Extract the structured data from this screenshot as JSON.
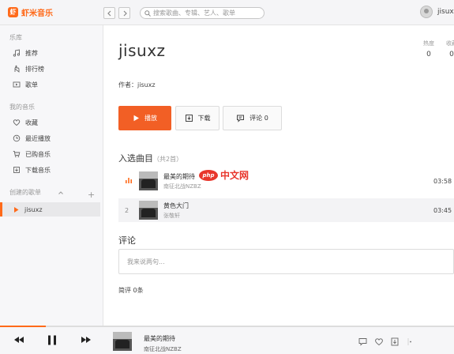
{
  "app": {
    "name": "虾米音乐",
    "logo_glyph": "虾",
    "accent": "#ff6a1a"
  },
  "search": {
    "placeholder": "搜索歌曲、专辑、艺人、歌单"
  },
  "user": {
    "name": "jisux"
  },
  "sidebar": {
    "section_library": "乐库",
    "library_items": [
      {
        "label": "推荐",
        "icon": "music-note-icon"
      },
      {
        "label": "排行榜",
        "icon": "hand-icon"
      },
      {
        "label": "歌单",
        "icon": "playlist-icon"
      }
    ],
    "section_my": "我的音乐",
    "my_items": [
      {
        "label": "收藏",
        "icon": "heart-icon"
      },
      {
        "label": "最近播放",
        "icon": "clock-icon"
      },
      {
        "label": "已购音乐",
        "icon": "cart-icon"
      },
      {
        "label": "下载音乐",
        "icon": "download-icon"
      }
    ],
    "section_created": "创建的歌单",
    "add_label": "+",
    "playlists": [
      {
        "label": "jisuxz",
        "icon": "play-icon"
      }
    ]
  },
  "playlist": {
    "title": "jisuxz",
    "stats": [
      {
        "label": "热度",
        "value": "0"
      },
      {
        "label": "收藏",
        "value": "0"
      }
    ],
    "author_label": "作者：",
    "author": "jisuxz",
    "play_label": "播放",
    "download_label": "下载",
    "comment_label": "评论 0"
  },
  "tracks": {
    "section_label": "入选曲目",
    "count_label": "（共2首）",
    "items": [
      {
        "num": "",
        "title": "最美的期待",
        "artist": "南征北战NZBZ",
        "duration": "03:58"
      },
      {
        "num": "2",
        "title": "黄色大门",
        "artist": "张敬轩",
        "duration": "03:45"
      }
    ]
  },
  "comments": {
    "section_label": "评论",
    "placeholder": "我来说两句...",
    "stat_label": "简评",
    "stat_count": "0条"
  },
  "watermark": {
    "badge": "php",
    "text": "中文网"
  },
  "player": {
    "song": "最美的期待",
    "artist": "南征北战NZBZ",
    "progress": 0.1,
    "icons": [
      "lyrics-icon",
      "heart-icon",
      "download-icon",
      "more-icon"
    ]
  }
}
